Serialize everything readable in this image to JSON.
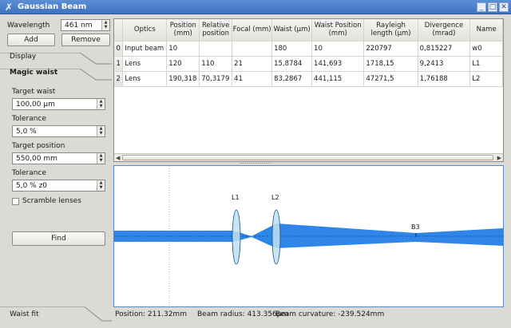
{
  "window": {
    "title": "Gaussian Beam",
    "controls": {
      "minimize": "_",
      "maximize": "□",
      "close": "✕"
    },
    "icon": "app-icon"
  },
  "left": {
    "wavelength_label": "Wavelength",
    "wavelength_value": "461 nm",
    "add_label": "Add",
    "remove_label": "Remove",
    "display_tab": "Display",
    "magic_waist_tab": "Magic waist",
    "target_waist_label": "Target waist",
    "target_waist_value": "100,00 µm",
    "tolerance1_label": "Tolerance",
    "tolerance1_value": "5,0 %",
    "target_position_label": "Target position",
    "target_position_value": "550,00 mm",
    "tolerance2_label": "Tolerance",
    "tolerance2_value": "5,0 % z0",
    "scramble_label": "Scramble lenses",
    "scramble_checked": false,
    "find_label": "Find",
    "waist_fit_tab": "Waist fit"
  },
  "table": {
    "headers": [
      "Optics",
      "Position (mm)",
      "Relative position",
      "Focal (mm)",
      "Waist (µm)",
      "Waist Position (mm)",
      "Rayleigh length (µm)",
      "Divergence (mrad)",
      "Name"
    ],
    "rows": [
      {
        "index": "0",
        "cells": [
          "Input beam",
          "10",
          "",
          "",
          "180",
          "10",
          "220797",
          "0,815227",
          "w0"
        ]
      },
      {
        "index": "1",
        "cells": [
          "Lens",
          "120",
          "110",
          "21",
          "15,8784",
          "141,693",
          "1718,15",
          "9,2413",
          "L1"
        ]
      },
      {
        "index": "2",
        "cells": [
          "Lens",
          "190,318",
          "70,3179",
          "41",
          "83,2867",
          "441,115",
          "47271,5",
          "1,76188",
          "L2"
        ]
      }
    ]
  },
  "plot": {
    "lens_labels": [
      "L1",
      "L2"
    ],
    "marker_label": "B3",
    "beam_color": "#2f86e8",
    "lens_color": "#bfe0f0"
  },
  "status": {
    "position": "Position: 211.32mm",
    "beam_radius": "Beam radius: 413.356µm",
    "beam_curvature": "Beam curvature: -239.524mm"
  }
}
